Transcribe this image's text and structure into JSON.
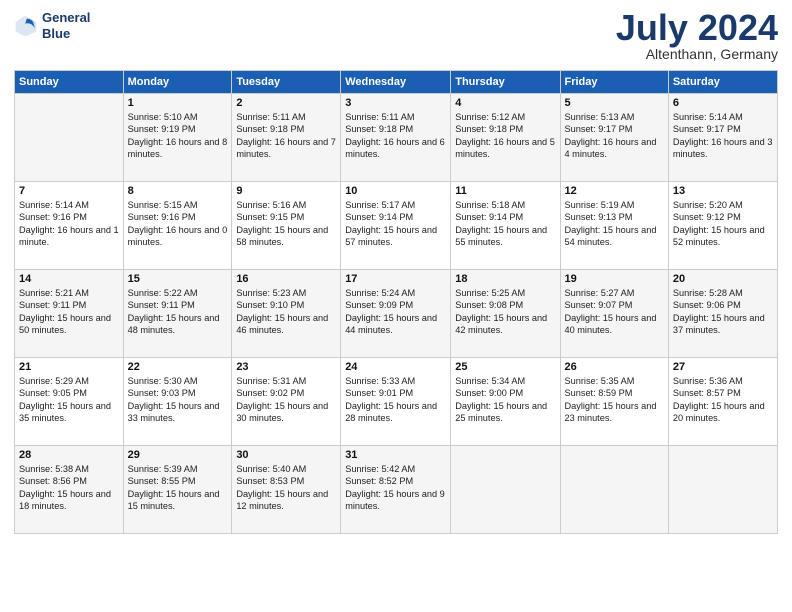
{
  "logo": {
    "line1": "General",
    "line2": "Blue"
  },
  "title": "July 2024",
  "subtitle": "Altenthann, Germany",
  "header_days": [
    "Sunday",
    "Monday",
    "Tuesday",
    "Wednesday",
    "Thursday",
    "Friday",
    "Saturday"
  ],
  "weeks": [
    [
      {
        "day": "",
        "sunrise": "",
        "sunset": "",
        "daylight": ""
      },
      {
        "day": "1",
        "sunrise": "Sunrise: 5:10 AM",
        "sunset": "Sunset: 9:19 PM",
        "daylight": "Daylight: 16 hours and 8 minutes."
      },
      {
        "day": "2",
        "sunrise": "Sunrise: 5:11 AM",
        "sunset": "Sunset: 9:18 PM",
        "daylight": "Daylight: 16 hours and 7 minutes."
      },
      {
        "day": "3",
        "sunrise": "Sunrise: 5:11 AM",
        "sunset": "Sunset: 9:18 PM",
        "daylight": "Daylight: 16 hours and 6 minutes."
      },
      {
        "day": "4",
        "sunrise": "Sunrise: 5:12 AM",
        "sunset": "Sunset: 9:18 PM",
        "daylight": "Daylight: 16 hours and 5 minutes."
      },
      {
        "day": "5",
        "sunrise": "Sunrise: 5:13 AM",
        "sunset": "Sunset: 9:17 PM",
        "daylight": "Daylight: 16 hours and 4 minutes."
      },
      {
        "day": "6",
        "sunrise": "Sunrise: 5:14 AM",
        "sunset": "Sunset: 9:17 PM",
        "daylight": "Daylight: 16 hours and 3 minutes."
      }
    ],
    [
      {
        "day": "7",
        "sunrise": "Sunrise: 5:14 AM",
        "sunset": "Sunset: 9:16 PM",
        "daylight": "Daylight: 16 hours and 1 minute."
      },
      {
        "day": "8",
        "sunrise": "Sunrise: 5:15 AM",
        "sunset": "Sunset: 9:16 PM",
        "daylight": "Daylight: 16 hours and 0 minutes."
      },
      {
        "day": "9",
        "sunrise": "Sunrise: 5:16 AM",
        "sunset": "Sunset: 9:15 PM",
        "daylight": "Daylight: 15 hours and 58 minutes."
      },
      {
        "day": "10",
        "sunrise": "Sunrise: 5:17 AM",
        "sunset": "Sunset: 9:14 PM",
        "daylight": "Daylight: 15 hours and 57 minutes."
      },
      {
        "day": "11",
        "sunrise": "Sunrise: 5:18 AM",
        "sunset": "Sunset: 9:14 PM",
        "daylight": "Daylight: 15 hours and 55 minutes."
      },
      {
        "day": "12",
        "sunrise": "Sunrise: 5:19 AM",
        "sunset": "Sunset: 9:13 PM",
        "daylight": "Daylight: 15 hours and 54 minutes."
      },
      {
        "day": "13",
        "sunrise": "Sunrise: 5:20 AM",
        "sunset": "Sunset: 9:12 PM",
        "daylight": "Daylight: 15 hours and 52 minutes."
      }
    ],
    [
      {
        "day": "14",
        "sunrise": "Sunrise: 5:21 AM",
        "sunset": "Sunset: 9:11 PM",
        "daylight": "Daylight: 15 hours and 50 minutes."
      },
      {
        "day": "15",
        "sunrise": "Sunrise: 5:22 AM",
        "sunset": "Sunset: 9:11 PM",
        "daylight": "Daylight: 15 hours and 48 minutes."
      },
      {
        "day": "16",
        "sunrise": "Sunrise: 5:23 AM",
        "sunset": "Sunset: 9:10 PM",
        "daylight": "Daylight: 15 hours and 46 minutes."
      },
      {
        "day": "17",
        "sunrise": "Sunrise: 5:24 AM",
        "sunset": "Sunset: 9:09 PM",
        "daylight": "Daylight: 15 hours and 44 minutes."
      },
      {
        "day": "18",
        "sunrise": "Sunrise: 5:25 AM",
        "sunset": "Sunset: 9:08 PM",
        "daylight": "Daylight: 15 hours and 42 minutes."
      },
      {
        "day": "19",
        "sunrise": "Sunrise: 5:27 AM",
        "sunset": "Sunset: 9:07 PM",
        "daylight": "Daylight: 15 hours and 40 minutes."
      },
      {
        "day": "20",
        "sunrise": "Sunrise: 5:28 AM",
        "sunset": "Sunset: 9:06 PM",
        "daylight": "Daylight: 15 hours and 37 minutes."
      }
    ],
    [
      {
        "day": "21",
        "sunrise": "Sunrise: 5:29 AM",
        "sunset": "Sunset: 9:05 PM",
        "daylight": "Daylight: 15 hours and 35 minutes."
      },
      {
        "day": "22",
        "sunrise": "Sunrise: 5:30 AM",
        "sunset": "Sunset: 9:03 PM",
        "daylight": "Daylight: 15 hours and 33 minutes."
      },
      {
        "day": "23",
        "sunrise": "Sunrise: 5:31 AM",
        "sunset": "Sunset: 9:02 PM",
        "daylight": "Daylight: 15 hours and 30 minutes."
      },
      {
        "day": "24",
        "sunrise": "Sunrise: 5:33 AM",
        "sunset": "Sunset: 9:01 PM",
        "daylight": "Daylight: 15 hours and 28 minutes."
      },
      {
        "day": "25",
        "sunrise": "Sunrise: 5:34 AM",
        "sunset": "Sunset: 9:00 PM",
        "daylight": "Daylight: 15 hours and 25 minutes."
      },
      {
        "day": "26",
        "sunrise": "Sunrise: 5:35 AM",
        "sunset": "Sunset: 8:59 PM",
        "daylight": "Daylight: 15 hours and 23 minutes."
      },
      {
        "day": "27",
        "sunrise": "Sunrise: 5:36 AM",
        "sunset": "Sunset: 8:57 PM",
        "daylight": "Daylight: 15 hours and 20 minutes."
      }
    ],
    [
      {
        "day": "28",
        "sunrise": "Sunrise: 5:38 AM",
        "sunset": "Sunset: 8:56 PM",
        "daylight": "Daylight: 15 hours and 18 minutes."
      },
      {
        "day": "29",
        "sunrise": "Sunrise: 5:39 AM",
        "sunset": "Sunset: 8:55 PM",
        "daylight": "Daylight: 15 hours and 15 minutes."
      },
      {
        "day": "30",
        "sunrise": "Sunrise: 5:40 AM",
        "sunset": "Sunset: 8:53 PM",
        "daylight": "Daylight: 15 hours and 12 minutes."
      },
      {
        "day": "31",
        "sunrise": "Sunrise: 5:42 AM",
        "sunset": "Sunset: 8:52 PM",
        "daylight": "Daylight: 15 hours and 9 minutes."
      },
      {
        "day": "",
        "sunrise": "",
        "sunset": "",
        "daylight": ""
      },
      {
        "day": "",
        "sunrise": "",
        "sunset": "",
        "daylight": ""
      },
      {
        "day": "",
        "sunrise": "",
        "sunset": "",
        "daylight": ""
      }
    ]
  ]
}
